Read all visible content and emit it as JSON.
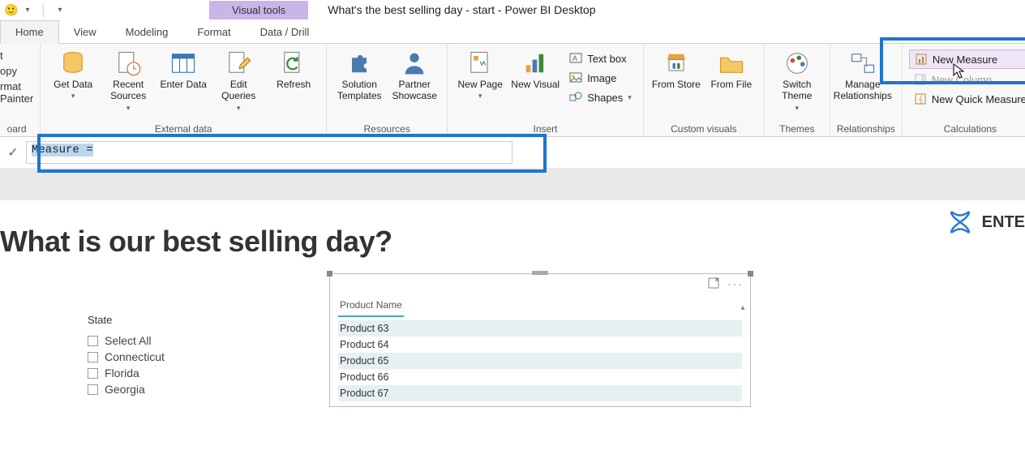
{
  "titlebar": {
    "visual_tools": "Visual tools",
    "title": "What's the best selling day - start - Power BI Desktop"
  },
  "tabs": {
    "home": "Home",
    "view": "View",
    "modeling": "Modeling",
    "format": "Format",
    "datadrill": "Data / Drill"
  },
  "ribbon": {
    "clipboard": {
      "cut": "t",
      "copy": "opy",
      "painter": "rmat Painter",
      "group": "oard"
    },
    "external": {
      "get": "Get Data",
      "recent": "Recent Sources",
      "enter": "Enter Data",
      "edit": "Edit Queries",
      "refresh": "Refresh",
      "group": "External data"
    },
    "resources": {
      "solution": "Solution Templates",
      "partner": "Partner Showcase",
      "group": "Resources"
    },
    "insert": {
      "page": "New Page",
      "visual": "New Visual",
      "textbox": "Text box",
      "image": "Image",
      "shapes": "Shapes",
      "group": "Insert"
    },
    "custom": {
      "store": "From Store",
      "file": "From File",
      "group": "Custom visuals"
    },
    "themes": {
      "switch": "Switch Theme",
      "group": "Themes"
    },
    "relationships": {
      "manage": "Manage Relationships",
      "group": "Relationships"
    },
    "calculations": {
      "measure": "New Measure",
      "column": "New Column",
      "quick": "New Quick Measure",
      "group": "Calculations"
    }
  },
  "formula": {
    "text": "Measure ="
  },
  "report": {
    "title": "What is our best selling day?",
    "logo": "ENTE"
  },
  "slicer": {
    "title": "State",
    "items": [
      "Select All",
      "Connecticut",
      "Florida",
      "Georgia"
    ]
  },
  "productVisual": {
    "header": "Product Name",
    "rows": [
      "Product 63",
      "Product 64",
      "Product 65",
      "Product 66",
      "Product 67"
    ]
  }
}
